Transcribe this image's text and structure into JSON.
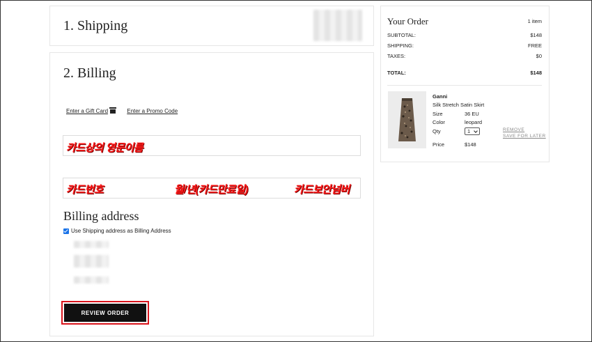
{
  "shipping": {
    "title": "1. Shipping"
  },
  "billing": {
    "title": "2. Billing",
    "gift_card_link": "Enter a Gift Card",
    "promo_link": "Enter a Promo Code",
    "name_annotation": "카드상의 영문이름",
    "card_number_annotation": "카드번호",
    "expiry_annotation": "월/년(카드만료일)",
    "cvv_annotation": "카드보안넘버",
    "address_heading": "Billing address",
    "use_shipping_label": "Use Shipping address as Billing Address",
    "use_shipping_checked": true,
    "review_button": "REVIEW ORDER"
  },
  "order": {
    "title": "Your Order",
    "item_count": "1 item",
    "subtotal_label": "SUBTOTAL:",
    "subtotal_value": "$148",
    "shipping_label": "SHIPPING:",
    "shipping_value": "FREE",
    "taxes_label": "TAXES:",
    "taxes_value": "$0",
    "total_label": "TOTAL:",
    "total_value": "$148",
    "item": {
      "brand": "Ganni",
      "name": "Silk Stretch Satin Skirt",
      "size_label": "Size",
      "size_value": "36 EU",
      "color_label": "Color",
      "color_value": "leopard",
      "qty_label": "Qty",
      "qty_value": "1",
      "price_label": "Price",
      "price_value": "$148",
      "remove_link": "REMOVE",
      "save_link": "SAVE FOR LATER"
    }
  },
  "colors": {
    "annotation_red": "#ff1a1a",
    "highlight_border": "#d9141c",
    "button_bg": "#111111",
    "checkbox_blue": "#1a73e8"
  }
}
